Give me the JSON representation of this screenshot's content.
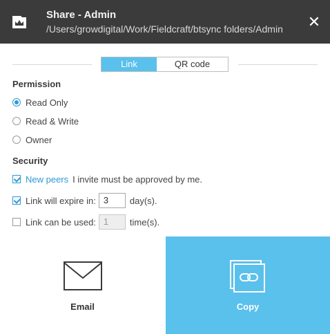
{
  "window": {
    "title": "Share - Admin",
    "path": "/Users/growdigital/Work/Fieldcraft/btsync folders/Admin",
    "close_symbol": "✕"
  },
  "tabs": [
    {
      "label": "Link",
      "active": true
    },
    {
      "label": "QR code",
      "active": false
    }
  ],
  "permission": {
    "heading": "Permission",
    "options": [
      {
        "label": "Read Only",
        "selected": true
      },
      {
        "label": "Read & Write",
        "selected": false
      },
      {
        "label": "Owner",
        "selected": false
      }
    ]
  },
  "security": {
    "heading": "Security",
    "new_peers": {
      "checked": true,
      "link_text": "New peers",
      "text": "I invite must be approved by me."
    },
    "expire": {
      "checked": true,
      "label": "Link will expire in:",
      "value": "3",
      "unit": "day(s)."
    },
    "usage": {
      "checked": false,
      "label": "Link can be used:",
      "value": "1",
      "unit": "time(s)."
    }
  },
  "actions": {
    "email_label": "Email",
    "copy_label": "Copy"
  },
  "colors": {
    "titlebar": "#3b3b3b",
    "accent": "#5ac0ec",
    "link": "#2b9ad6"
  },
  "icons": [
    "app-icon",
    "close-icon",
    "envelope-icon",
    "copy-link-icon"
  ]
}
